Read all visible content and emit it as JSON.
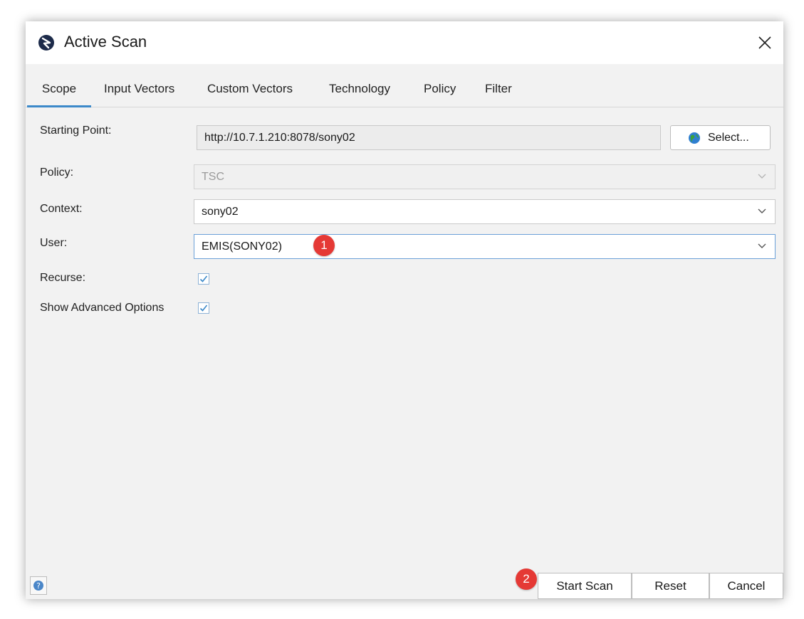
{
  "window": {
    "title": "Active Scan",
    "icon": "zap-logo-icon"
  },
  "tabs": [
    {
      "label": "Scope",
      "active": true
    },
    {
      "label": "Input Vectors"
    },
    {
      "label": "Custom Vectors"
    },
    {
      "label": "Technology"
    },
    {
      "label": "Policy"
    },
    {
      "label": "Filter"
    }
  ],
  "form": {
    "starting_point": {
      "label": "Starting Point:",
      "value": "http://10.7.1.210:8078/sony02",
      "button": "Select..."
    },
    "policy": {
      "label": "Policy:",
      "value": "TSC"
    },
    "context": {
      "label": "Context:",
      "value": "sony02"
    },
    "user": {
      "label": "User:",
      "value": "EMIS(SONY02)"
    },
    "recurse": {
      "label": "Recurse:",
      "checked": true
    },
    "advanced": {
      "label": "Show Advanced Options",
      "checked": true
    }
  },
  "annotations": {
    "step1": "1",
    "step2": "2"
  },
  "buttons": {
    "start": "Start Scan",
    "reset": "Reset",
    "cancel": "Cancel"
  },
  "colors": {
    "accent": "#3c89c9",
    "badge": "#e53935"
  }
}
